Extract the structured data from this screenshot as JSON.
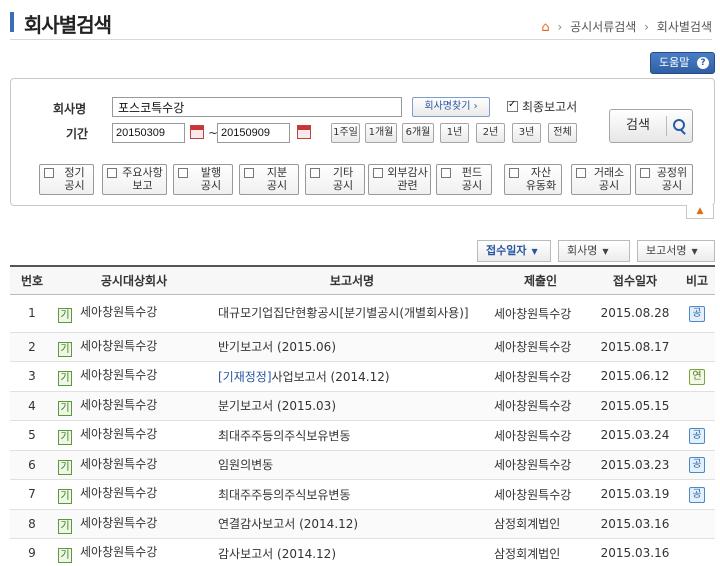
{
  "header": {
    "title": "회사별검색",
    "breadcrumb": [
      "공시서류검색",
      "회사별검색"
    ],
    "help_label": "도움말"
  },
  "search": {
    "company_label": "회사명",
    "company_value": "포스코특수강",
    "find_company_label": "회사명찾기 ›",
    "latest_report_label": "최종보고서",
    "latest_report_checked": true,
    "period_label": "기간",
    "date_from": "20150309",
    "date_to": "20150909",
    "range_buttons": [
      "1주일",
      "1개월",
      "6개월",
      "1년",
      "2년",
      "3년",
      "전체"
    ],
    "search_button": "검색",
    "categories": [
      "정기\n공시",
      "주요사항\n보고",
      "발행\n공시",
      "지분\n공시",
      "기타\n공시",
      "외부감사\n관련",
      "펀드\n공시",
      "자산\n유동화",
      "거래소\n공시",
      "공정위\n공시"
    ]
  },
  "sort": {
    "buttons": [
      "접수일자",
      "회사명",
      "보고서명"
    ],
    "active": "접수일자"
  },
  "table": {
    "headers": [
      "번호",
      "공시대상회사",
      "보고서명",
      "제출인",
      "접수일자",
      "비고"
    ],
    "rows": [
      {
        "no": "1",
        "market": "기",
        "company": "세아창원특수강",
        "prefix": "",
        "report": "대규모기업집단현황공시[분기별공시(개별회사용)]",
        "submitter": "세아창원특수강",
        "date": "2015.08.28",
        "note": "공"
      },
      {
        "no": "2",
        "market": "기",
        "company": "세아창원특수강",
        "prefix": "",
        "report": "반기보고서 (2015.06)",
        "submitter": "세아창원특수강",
        "date": "2015.08.17",
        "note": ""
      },
      {
        "no": "3",
        "market": "기",
        "company": "세아창원특수강",
        "prefix": "[기재정정]",
        "report": "사업보고서 (2014.12)",
        "submitter": "세아창원특수강",
        "date": "2015.06.12",
        "note": "연"
      },
      {
        "no": "4",
        "market": "기",
        "company": "세아창원특수강",
        "prefix": "",
        "report": "분기보고서 (2015.03)",
        "submitter": "세아창원특수강",
        "date": "2015.05.15",
        "note": ""
      },
      {
        "no": "5",
        "market": "기",
        "company": "세아창원특수강",
        "prefix": "",
        "report": "최대주주등의주식보유변동",
        "submitter": "세아창원특수강",
        "date": "2015.03.24",
        "note": "공"
      },
      {
        "no": "6",
        "market": "기",
        "company": "세아창원특수강",
        "prefix": "",
        "report": "임원의변동",
        "submitter": "세아창원특수강",
        "date": "2015.03.23",
        "note": "공"
      },
      {
        "no": "7",
        "market": "기",
        "company": "세아창원특수강",
        "prefix": "",
        "report": "최대주주등의주식보유변동",
        "submitter": "세아창원특수강",
        "date": "2015.03.19",
        "note": "공"
      },
      {
        "no": "8",
        "market": "기",
        "company": "세아창원특수강",
        "prefix": "",
        "report": "연결감사보고서 (2014.12)",
        "submitter": "삼정회계법인",
        "date": "2015.03.16",
        "note": ""
      },
      {
        "no": "9",
        "market": "기",
        "company": "세아창원특수강",
        "prefix": "",
        "report": "감사보고서 (2014.12)",
        "submitter": "삼정회계법인",
        "date": "2015.03.16",
        "note": ""
      }
    ]
  }
}
